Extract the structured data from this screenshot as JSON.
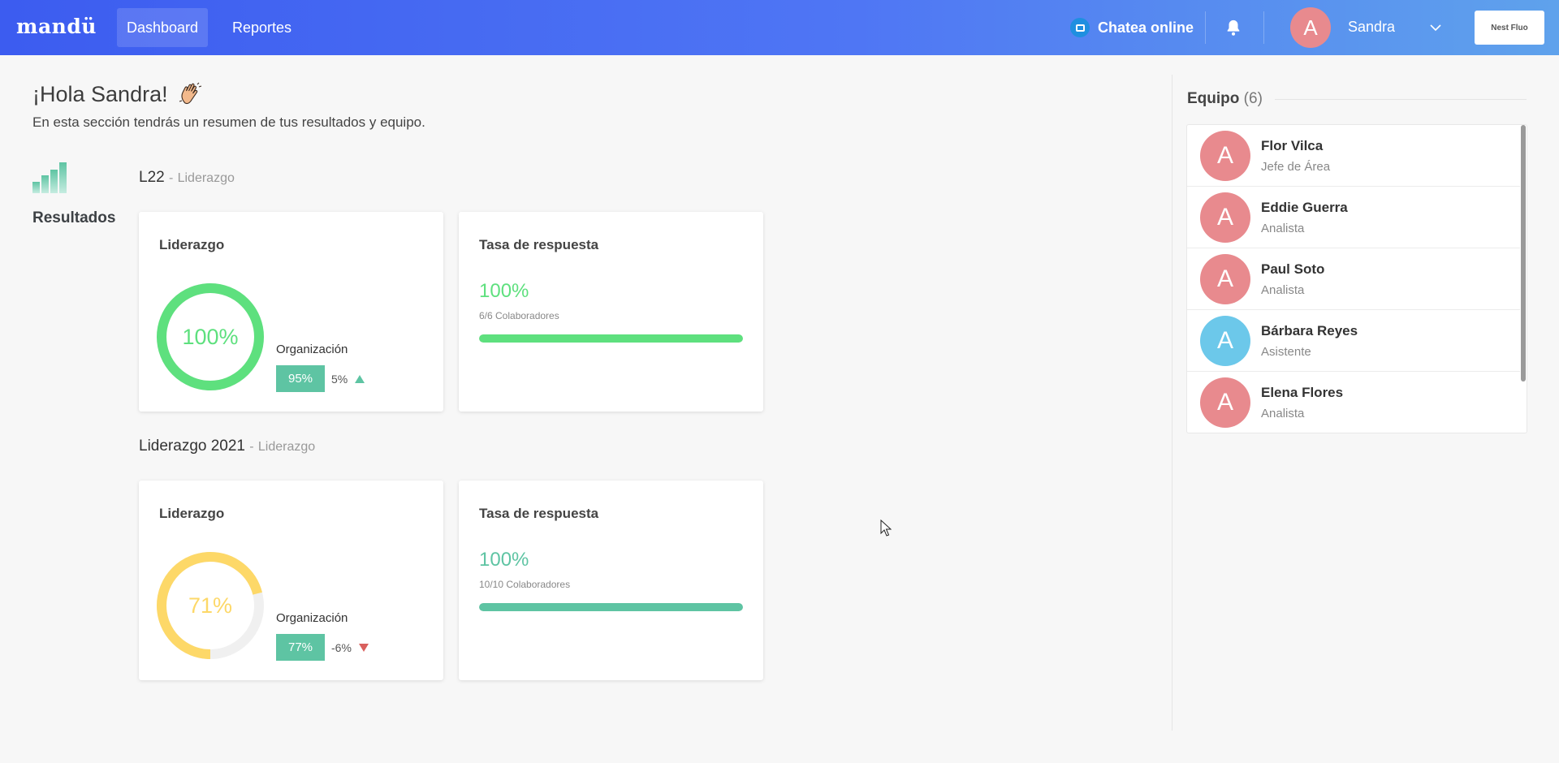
{
  "header": {
    "logo": "mandü",
    "nav": [
      {
        "label": "Dashboard",
        "active": true
      },
      {
        "label": "Reportes",
        "active": false
      }
    ],
    "chat_label": "Chatea online",
    "chat_icon": "chat-bubble-icon",
    "bell_icon": "bell-icon",
    "user": {
      "initial": "A",
      "name": "Sandra"
    },
    "brand_button": "Nest Fluo"
  },
  "greeting": {
    "title": "¡Hola Sandra!",
    "subtitle": "En esta sección tendrás un resumen de tus resultados y equipo."
  },
  "results": {
    "label": "Resultados",
    "icon": "bar-chart-icon",
    "surveys": [
      {
        "name": "L22",
        "separator": "-",
        "category": "Liderazgo",
        "leadership": {
          "title": "Liderazgo",
          "value": "100%",
          "fraction": 1.0,
          "color": "#5ee07e",
          "org_label": "Organización",
          "org_value": "95%",
          "org_diff": "5%",
          "trend": "up"
        },
        "response": {
          "title": "Tasa de respuesta",
          "value": "100%",
          "detail": "6/6 Colaboradores",
          "fraction": 1.0,
          "color": "#5ee07e"
        }
      },
      {
        "name": "Liderazgo 2021",
        "separator": "-",
        "category": "Liderazgo",
        "leadership": {
          "title": "Liderazgo",
          "value": "71%",
          "fraction": 0.71,
          "color": "#fdd868",
          "org_label": "Organización",
          "org_value": "77%",
          "org_diff": "-6%",
          "trend": "down"
        },
        "response": {
          "title": "Tasa de respuesta",
          "value": "100%",
          "detail": "10/10 Colaboradores",
          "fraction": 1.0,
          "color": "#5ec4a3"
        }
      }
    ]
  },
  "team": {
    "title": "Equipo",
    "count": "(6)",
    "members": [
      {
        "initial": "A",
        "name": "Flor Vilca",
        "role": "Jefe de Área",
        "color": "#e88a8e"
      },
      {
        "initial": "A",
        "name": "Eddie Guerra",
        "role": "Analista",
        "color": "#e88a8e"
      },
      {
        "initial": "A",
        "name": "Paul Soto",
        "role": "Analista",
        "color": "#e88a8e"
      },
      {
        "initial": "A",
        "name": "Bárbara Reyes",
        "role": "Asistente",
        "color": "#6cc8ea"
      },
      {
        "initial": "A",
        "name": "Elena Flores",
        "role": "Analista",
        "color": "#e88a8e"
      }
    ]
  }
}
